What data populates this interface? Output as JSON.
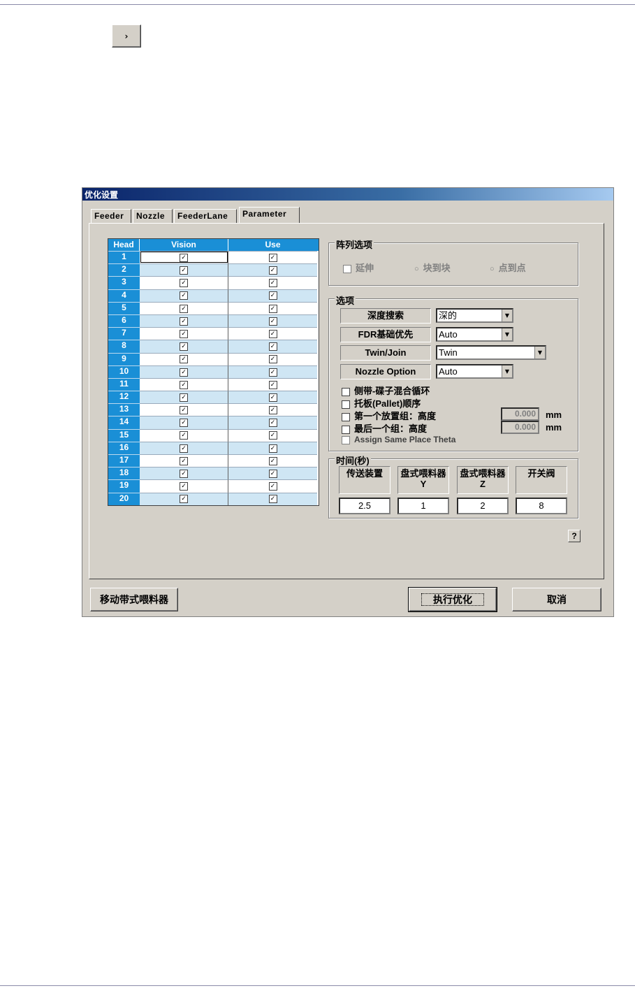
{
  "next_button": {
    "glyph": "›"
  },
  "dialog": {
    "title": "优化设置",
    "tabs": [
      {
        "label": "Feeder"
      },
      {
        "label": "Nozzle"
      },
      {
        "label": "FeederLane"
      },
      {
        "label": "Parameter"
      }
    ],
    "grid": {
      "headers": {
        "head": "Head",
        "vision": "Vision",
        "use": "Use"
      },
      "rows": [
        {
          "head": "1",
          "vision": "☑",
          "use": "☑"
        },
        {
          "head": "2",
          "vision": "☑",
          "use": "☑"
        },
        {
          "head": "3",
          "vision": "☑",
          "use": "☑"
        },
        {
          "head": "4",
          "vision": "☑",
          "use": "☑"
        },
        {
          "head": "5",
          "vision": "☑",
          "use": "☑"
        },
        {
          "head": "6",
          "vision": "☑",
          "use": "☑"
        },
        {
          "head": "7",
          "vision": "☑",
          "use": "☑"
        },
        {
          "head": "8",
          "vision": "☑",
          "use": "☑"
        },
        {
          "head": "9",
          "vision": "☑",
          "use": "☑"
        },
        {
          "head": "10",
          "vision": "☑",
          "use": "☑"
        },
        {
          "head": "11",
          "vision": "☑",
          "use": "☑"
        },
        {
          "head": "12",
          "vision": "☑",
          "use": "☑"
        },
        {
          "head": "13",
          "vision": "☑",
          "use": "☑"
        },
        {
          "head": "14",
          "vision": "☑",
          "use": "☑"
        },
        {
          "head": "15",
          "vision": "☑",
          "use": "☑"
        },
        {
          "head": "16",
          "vision": "☑",
          "use": "☑"
        },
        {
          "head": "17",
          "vision": "☑",
          "use": "☑"
        },
        {
          "head": "18",
          "vision": "☑",
          "use": "☑"
        },
        {
          "head": "19",
          "vision": "☑",
          "use": "☑"
        },
        {
          "head": "20",
          "vision": "☑",
          "use": "☑"
        }
      ]
    },
    "array_options": {
      "title": "阵列选项",
      "extend": "延伸",
      "block_to_block": "块到块",
      "point_to_point": "点到点"
    },
    "options": {
      "title": "选项",
      "depth_search": {
        "label": "深度搜索",
        "value": "深的"
      },
      "fdr_priority": {
        "label": "FDR基础优先",
        "value": "Auto"
      },
      "twin_join": {
        "label": "Twin/Join",
        "value": "Twin"
      },
      "nozzle_option": {
        "label": "Nozzle Option",
        "value": "Auto"
      },
      "cb_mixed_cycle": "侧带-碟子混合循环",
      "cb_pallet_order": "托板(Pallet)顺序",
      "cb_first_group": "第一个放置组：高度",
      "cb_last_group": "最后一个组：高度",
      "cb_same_theta": "Assign Same Place Theta",
      "first_height": "0.000",
      "last_height": "0.000",
      "unit": "mm"
    },
    "time": {
      "title": "时间(秒)",
      "columns": [
        {
          "header": "传送装置",
          "value": "2.5"
        },
        {
          "header": "盘式喂料器Y",
          "value": "1"
        },
        {
          "header": "盘式喂料器Z",
          "value": "2"
        },
        {
          "header": "开关阀",
          "value": "8"
        }
      ]
    },
    "help": "?",
    "buttons": {
      "move_feeder": "移动带式喂料器",
      "execute": "执行优化",
      "cancel": "取消"
    }
  }
}
